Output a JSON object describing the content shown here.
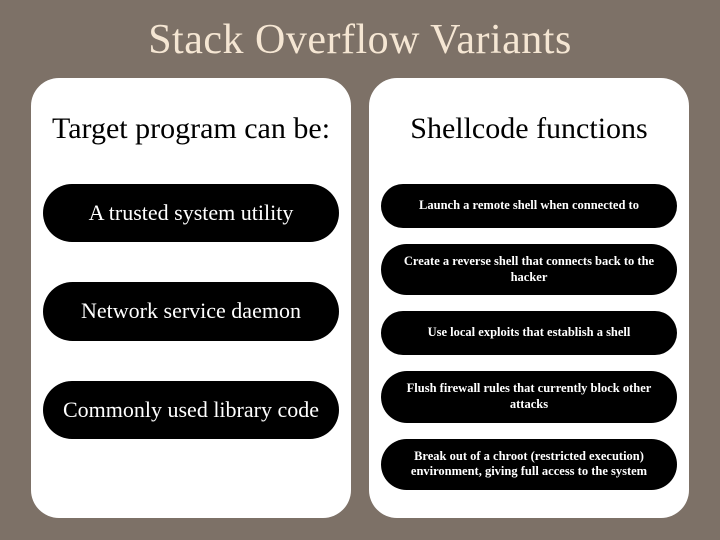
{
  "title": "Stack Overflow Variants",
  "left": {
    "heading": "Target program can be:",
    "items": [
      "A trusted system utility",
      "Network service daemon",
      "Commonly used library code"
    ]
  },
  "right": {
    "heading": "Shellcode functions",
    "items": [
      "Launch a remote shell when connected to",
      "Create a reverse shell that connects back to the hacker",
      "Use local exploits that establish a shell",
      "Flush firewall rules that currently block other attacks",
      "Break out of a chroot (restricted execution) environment, giving full access to the system"
    ]
  }
}
